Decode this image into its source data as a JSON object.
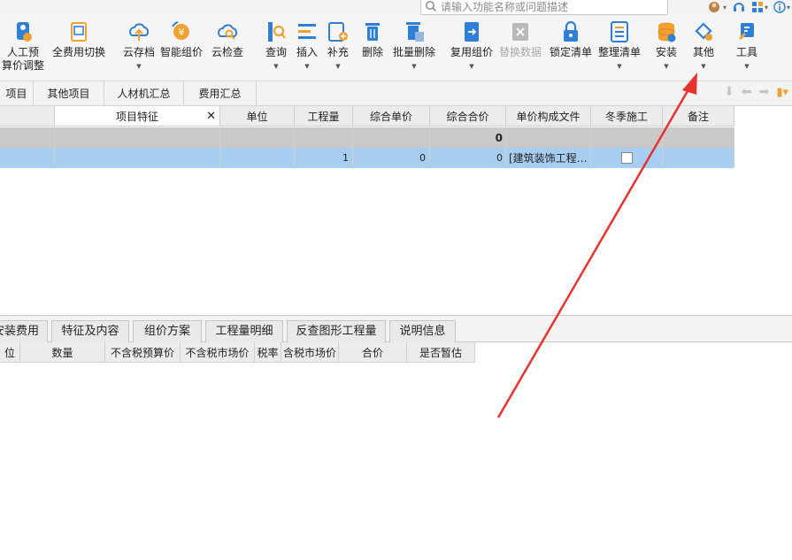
{
  "search": {
    "placeholder": "请输入功能名称或问题描述"
  },
  "toolbar": {
    "items": [
      {
        "label": "人工预\n算价调整",
        "icon": "labor-price-icon"
      },
      {
        "label": "全费用切换",
        "icon": "full-cost-toggle-icon"
      },
      {
        "label": "云存档",
        "icon": "cloud-save-icon"
      },
      {
        "label": "智能组价",
        "icon": "smart-pricing-icon"
      },
      {
        "label": "云检查",
        "icon": "cloud-check-icon"
      },
      {
        "label": "查询",
        "icon": "query-icon"
      },
      {
        "label": "插入",
        "icon": "insert-icon"
      },
      {
        "label": "补充",
        "icon": "supplement-icon"
      },
      {
        "label": "删除",
        "icon": "trash-icon"
      },
      {
        "label": "批量删除",
        "icon": "batch-delete-icon"
      },
      {
        "label": "复用组价",
        "icon": "reuse-pricing-icon"
      },
      {
        "label": "替换数据",
        "icon": "replace-data-icon"
      },
      {
        "label": "锁定清单",
        "icon": "lock-list-icon"
      },
      {
        "label": "整理清单",
        "icon": "organize-list-icon"
      },
      {
        "label": "安装",
        "icon": "install-icon"
      },
      {
        "label": "其他",
        "icon": "other-icon"
      },
      {
        "label": "工具",
        "icon": "tools-icon"
      }
    ]
  },
  "tabs": [
    "项目",
    "其他项目",
    "人材机汇总",
    "费用汇总"
  ],
  "grid": {
    "headers": [
      "项目特征",
      "单位",
      "工程量",
      "综合单价",
      "综合合价",
      "单价构成文件",
      "冬季施工",
      "备注"
    ],
    "summary_row": {
      "total": "0"
    },
    "data_row": {
      "quantity": "1",
      "unit_price": "0",
      "total_price": "0",
      "file": "[建筑装饰工程…",
      "winter_checked": false
    }
  },
  "lower": {
    "tabs": [
      "安装费用",
      "特征及内容",
      "组价方案",
      "工程量明细",
      "反查图形工程量",
      "说明信息"
    ],
    "headers": [
      "位",
      "数量",
      "不含税预算价",
      "不含税市场价",
      "税率",
      "含税市场价",
      "合价",
      "是否暂估"
    ]
  },
  "colors": {
    "accent_blue": "#2f7fd6",
    "orange": "#f0a030",
    "selection_row": "#a7cdf0",
    "annotation_arrow": "#e8322e"
  }
}
